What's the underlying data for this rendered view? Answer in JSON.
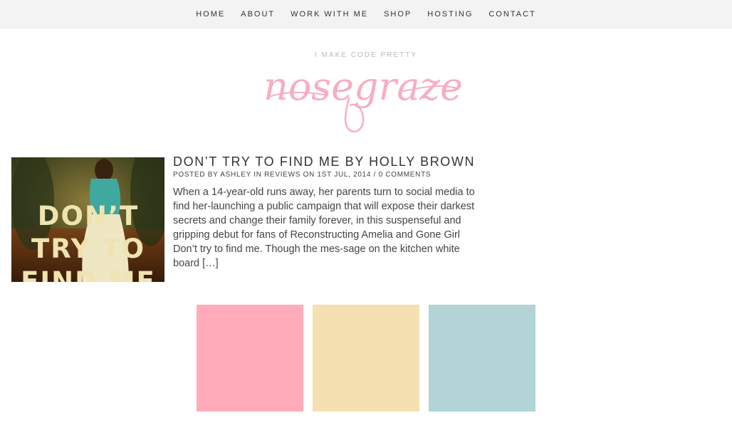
{
  "nav": {
    "items": [
      {
        "label": "HOME"
      },
      {
        "label": "ABOUT"
      },
      {
        "label": "WORK WITH ME"
      },
      {
        "label": "SHOP"
      },
      {
        "label": "HOSTING"
      },
      {
        "label": "CONTACT"
      }
    ]
  },
  "header": {
    "tagline": "I MAKE CODE PRETTY",
    "logo_text": "nosegraze",
    "logo_color": "#f7aec0"
  },
  "post": {
    "title": "DON’T TRY TO FIND ME BY HOLLY BROWN",
    "meta": {
      "prefix": "POSTED BY ",
      "author": "ASHLEY",
      "in": " IN ",
      "category": "REVIEWS",
      "on": " ON 1ST JUL, 2014 / ",
      "comments": "0 COMMENTS"
    },
    "excerpt": "When a 14-year-old runs away, her parents turn to social media to find her-launching a public campaign that will expose their darkest secrets and change their family forever, in this suspenseful and gripping debut for fans of Reconstructing Amelia and Gone Girl Don’t try to find me. Though the mes-sage on the kitchen white board […]",
    "thumbnail": {
      "line1": "DON’T",
      "line2": "TRY TO",
      "line3": "FIND ME"
    }
  },
  "swatches": [
    {
      "color": "#ffabb9"
    },
    {
      "color": "#f4e0b0"
    },
    {
      "color": "#b2d4d6"
    }
  ]
}
